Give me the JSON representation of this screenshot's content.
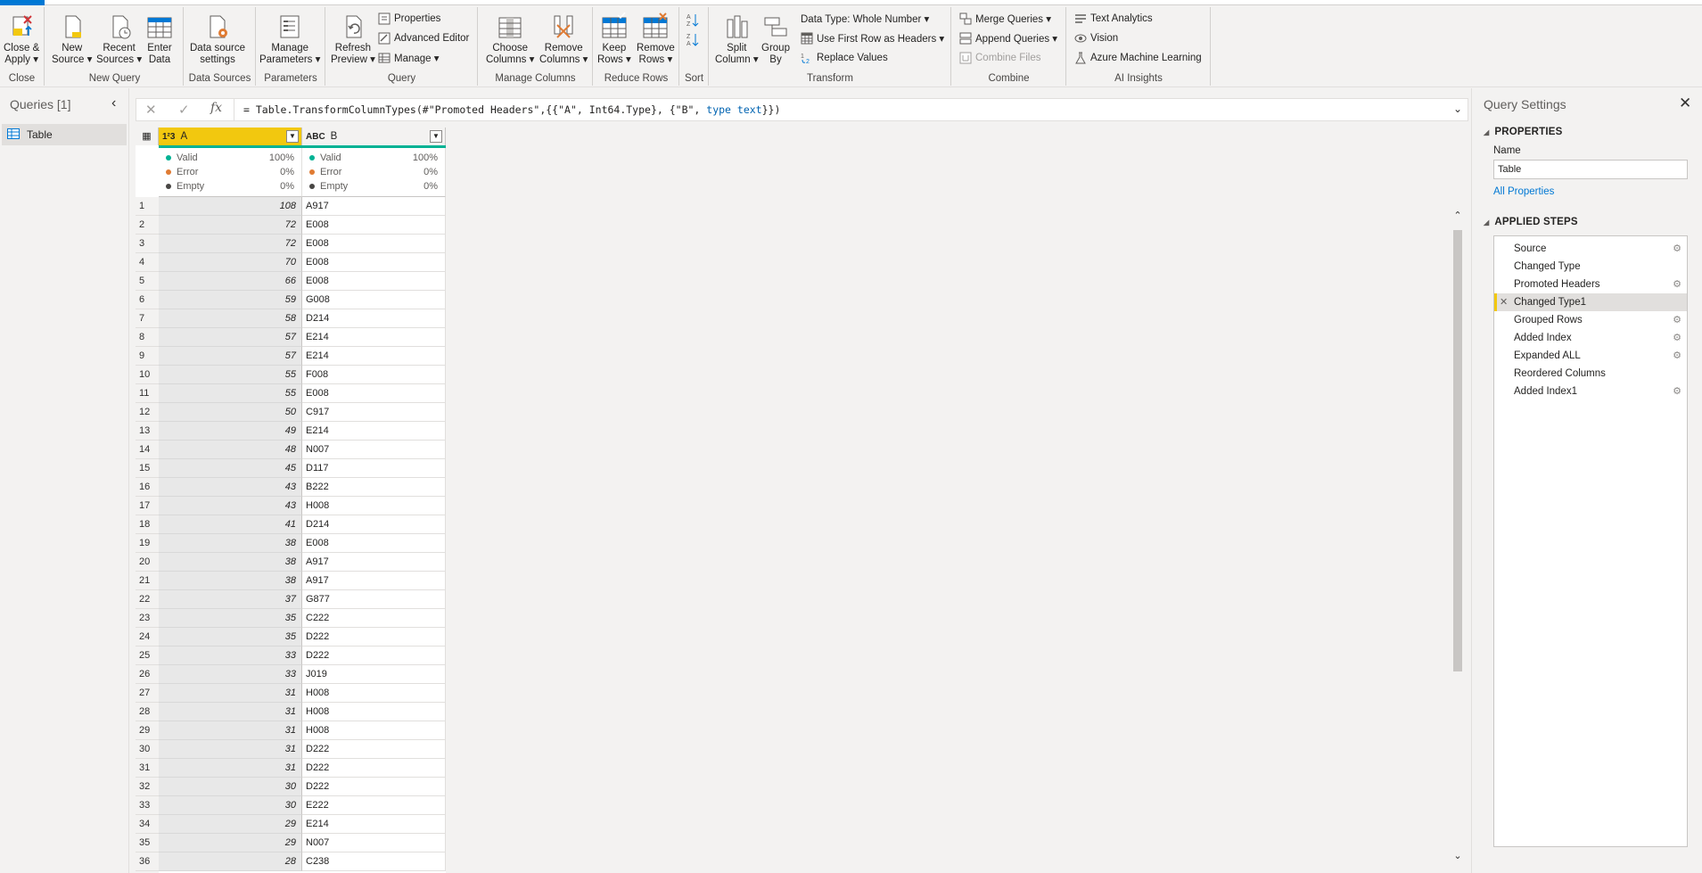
{
  "ribbon": {
    "groups": {
      "close": "Close",
      "new_query": "New Query",
      "data_sources": "Data Sources",
      "parameters": "Parameters",
      "query": "Query",
      "manage_columns": "Manage Columns",
      "reduce_rows": "Reduce Rows",
      "sort": "Sort",
      "transform": "Transform",
      "combine": "Combine",
      "ai_insights": "AI Insights"
    },
    "buttons": {
      "close_apply": "Close &\nApply ▾",
      "new_source": "New\nSource ▾",
      "recent_sources": "Recent\nSources ▾",
      "enter_data": "Enter\nData",
      "data_source_settings": "Data source\nsettings",
      "manage_parameters": "Manage\nParameters ▾",
      "refresh_preview": "Refresh\nPreview ▾",
      "properties": "Properties",
      "advanced_editor": "Advanced Editor",
      "manage": "Manage ▾",
      "choose_columns": "Choose\nColumns ▾",
      "remove_columns": "Remove\nColumns ▾",
      "keep_rows": "Keep\nRows ▾",
      "remove_rows": "Remove\nRows ▾",
      "split_column": "Split\nColumn ▾",
      "group_by": "Group\nBy",
      "data_type": "Data Type: Whole Number ▾",
      "use_first_row": "Use First Row as Headers ▾",
      "replace_values": "Replace Values",
      "merge_queries": "Merge Queries ▾",
      "append_queries": "Append Queries ▾",
      "combine_files": "Combine Files",
      "text_analytics": "Text Analytics",
      "vision": "Vision",
      "azure_ml": "Azure Machine Learning"
    }
  },
  "queries_pane": {
    "title": "Queries [1]",
    "items": [
      {
        "label": "Table"
      }
    ]
  },
  "formula": {
    "prefix": "= Table.TransformColumnTypes(#\"Promoted Headers\",{{\"A\", Int64.Type}, {\"B\", ",
    "keyword": "type text",
    "suffix": "}})"
  },
  "grid": {
    "columns": [
      {
        "name": "A",
        "type_icon": "1²3",
        "valid": "100%",
        "error": "0%",
        "empty": "0%"
      },
      {
        "name": "B",
        "type_icon": "ABC",
        "valid": "100%",
        "error": "0%",
        "empty": "0%"
      }
    ],
    "quality_labels": {
      "valid": "Valid",
      "error": "Error",
      "empty": "Empty"
    },
    "colors": {
      "valid": "#00b294",
      "error": "#e07b33",
      "empty": "#484644",
      "header_accent": "#f2c80f"
    },
    "rows": [
      [
        "1",
        "108",
        "A917"
      ],
      [
        "2",
        "72",
        "E008"
      ],
      [
        "3",
        "72",
        "E008"
      ],
      [
        "4",
        "70",
        "E008"
      ],
      [
        "5",
        "66",
        "E008"
      ],
      [
        "6",
        "59",
        "G008"
      ],
      [
        "7",
        "58",
        "D214"
      ],
      [
        "8",
        "57",
        "E214"
      ],
      [
        "9",
        "57",
        "E214"
      ],
      [
        "10",
        "55",
        "F008"
      ],
      [
        "11",
        "55",
        "E008"
      ],
      [
        "12",
        "50",
        "C917"
      ],
      [
        "13",
        "49",
        "E214"
      ],
      [
        "14",
        "48",
        "N007"
      ],
      [
        "15",
        "45",
        "D117"
      ],
      [
        "16",
        "43",
        "B222"
      ],
      [
        "17",
        "43",
        "H008"
      ],
      [
        "18",
        "41",
        "D214"
      ],
      [
        "19",
        "38",
        "E008"
      ],
      [
        "20",
        "38",
        "A917"
      ],
      [
        "21",
        "38",
        "A917"
      ],
      [
        "22",
        "37",
        "G877"
      ],
      [
        "23",
        "35",
        "C222"
      ],
      [
        "24",
        "35",
        "D222"
      ],
      [
        "25",
        "33",
        "D222"
      ],
      [
        "26",
        "33",
        "J019"
      ],
      [
        "27",
        "31",
        "H008"
      ],
      [
        "28",
        "31",
        "H008"
      ],
      [
        "29",
        "31",
        "H008"
      ],
      [
        "30",
        "31",
        "D222"
      ],
      [
        "31",
        "31",
        "D222"
      ],
      [
        "32",
        "30",
        "D222"
      ],
      [
        "33",
        "30",
        "E222"
      ],
      [
        "34",
        "29",
        "E214"
      ],
      [
        "35",
        "29",
        "N007"
      ],
      [
        "36",
        "28",
        "C238"
      ]
    ]
  },
  "settings": {
    "title": "Query Settings",
    "properties_header": "PROPERTIES",
    "name_label": "Name",
    "name_value": "Table",
    "all_properties": "All Properties",
    "steps_header": "APPLIED STEPS",
    "steps": [
      {
        "label": "Source",
        "gear": true,
        "selected": false
      },
      {
        "label": "Changed Type",
        "gear": false,
        "selected": false
      },
      {
        "label": "Promoted Headers",
        "gear": true,
        "selected": false
      },
      {
        "label": "Changed Type1",
        "gear": false,
        "selected": true
      },
      {
        "label": "Grouped Rows",
        "gear": true,
        "selected": false
      },
      {
        "label": "Added Index",
        "gear": true,
        "selected": false
      },
      {
        "label": "Expanded ALL",
        "gear": true,
        "selected": false
      },
      {
        "label": "Reordered Columns",
        "gear": false,
        "selected": false
      },
      {
        "label": "Added Index1",
        "gear": true,
        "selected": false
      }
    ]
  }
}
